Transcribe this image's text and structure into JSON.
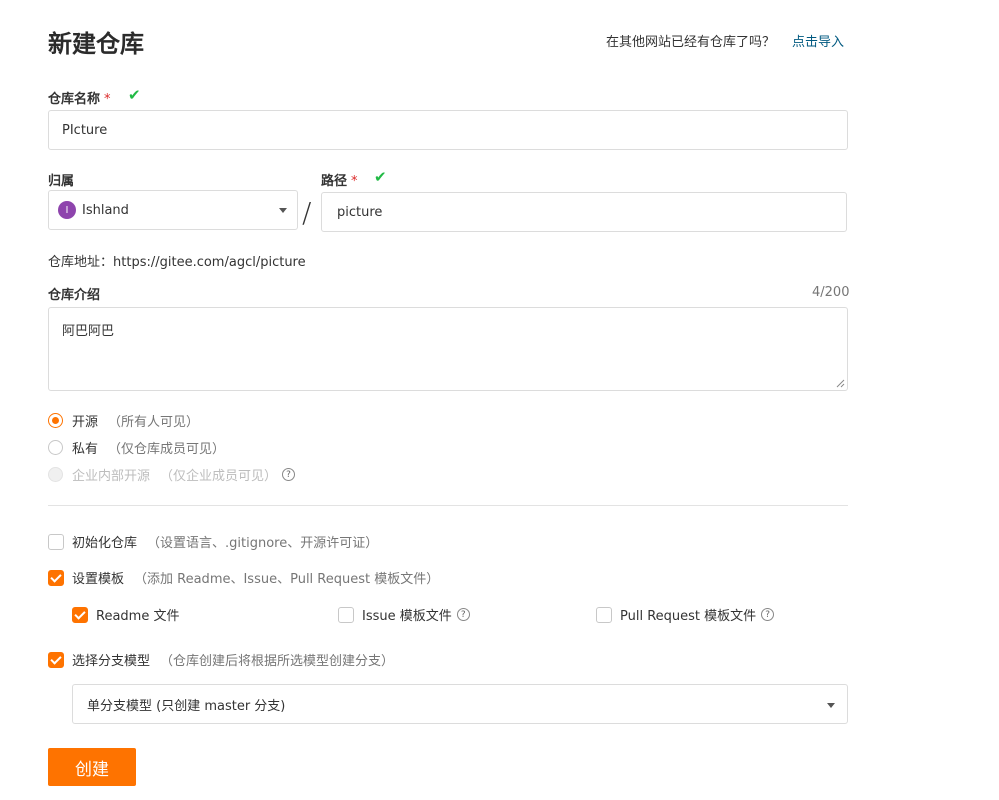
{
  "page": {
    "title": "新建仓库",
    "import_question": "在其他网站已经有仓库了吗？",
    "import_link": "点击导入"
  },
  "repo_name": {
    "label": "仓库名称",
    "required_mark": "*",
    "value": "PIcture"
  },
  "owner": {
    "label": "归属",
    "avatar_letter": "I",
    "value": "Ishland",
    "avatar_color": "#8e44ad"
  },
  "separator": "/",
  "path": {
    "label": "路径",
    "required_mark": "*",
    "value": "picture"
  },
  "repo_url": {
    "label": "仓库地址：",
    "value": "https://gitee.com/agcl/picture"
  },
  "description": {
    "label": "仓库介绍",
    "counter": "4/200",
    "value": "阿巴阿巴"
  },
  "visibility": {
    "options": [
      {
        "label": "开源",
        "hint": "（所有人可见）",
        "selected": true,
        "disabled": false
      },
      {
        "label": "私有",
        "hint": "（仅仓库成员可见）",
        "selected": false,
        "disabled": false
      },
      {
        "label": "企业内部开源",
        "hint": "（仅企业成员可见）",
        "selected": false,
        "disabled": true
      }
    ],
    "help_icon": "question-circle-icon"
  },
  "init_repo": {
    "label": "初始化仓库",
    "hint": "（设置语言、.gitignore、开源许可证）",
    "checked": false
  },
  "template": {
    "label": "设置模板",
    "hint": "（添加 Readme、Issue、Pull Request 模板文件）",
    "checked": true,
    "options": [
      {
        "label": "Readme 文件",
        "checked": true
      },
      {
        "label": "Issue 模板文件",
        "checked": false
      },
      {
        "label": "Pull Request 模板文件",
        "checked": false
      }
    ]
  },
  "branch_model": {
    "label": "选择分支模型",
    "hint": "（仓库创建后将根据所选模型创建分支）",
    "checked": true,
    "selected": "单分支模型 (只创建 master 分支)"
  },
  "create_button": "创建",
  "colors": {
    "accent": "#fe7300",
    "link": "#005980",
    "success": "#21ba45",
    "required": "#db2828"
  }
}
